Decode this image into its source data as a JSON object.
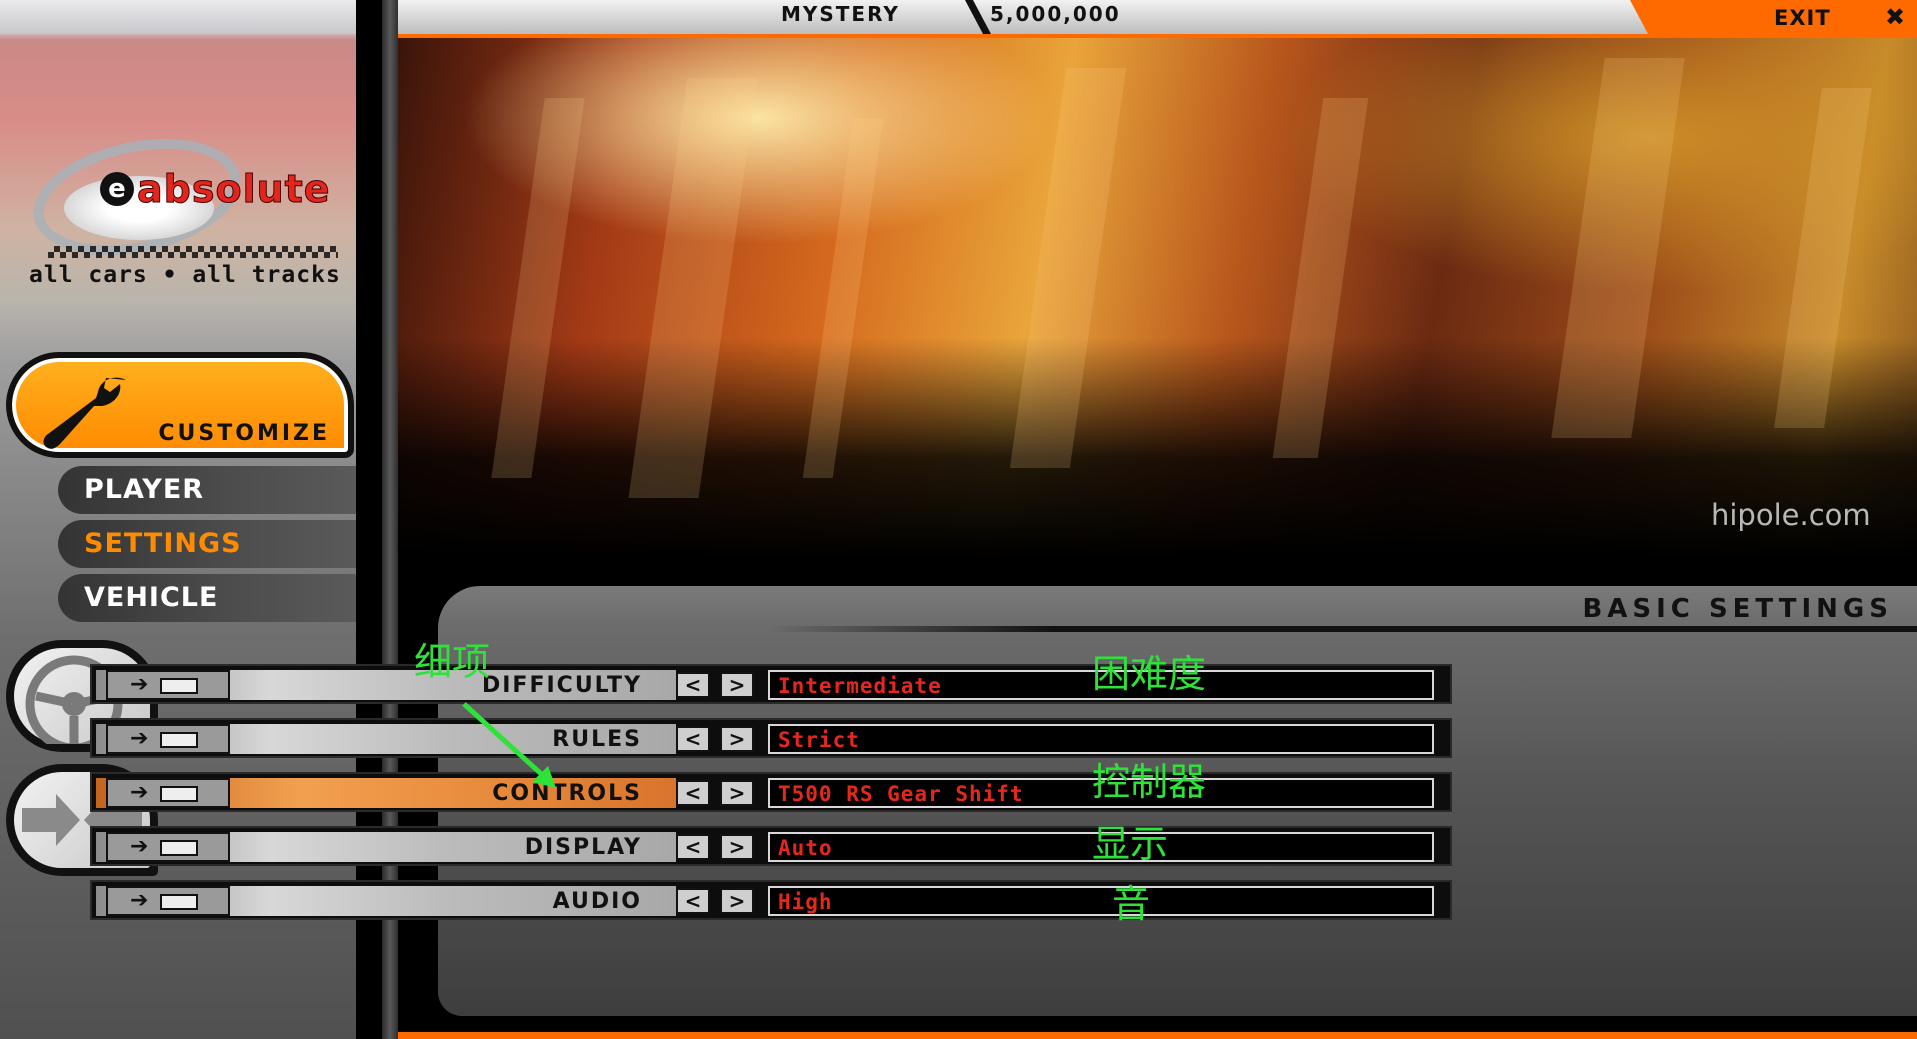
{
  "sidebar": {
    "logo_text": "absolute",
    "logo_badge": "e",
    "tagline": "all cars • all tracks",
    "customize_label": "CUSTOMIZE",
    "nav": [
      {
        "label": "PLAYER",
        "active": false
      },
      {
        "label": "SETTINGS",
        "active": true
      },
      {
        "label": "VEHICLE",
        "active": false
      }
    ]
  },
  "topbar": {
    "mode": "MYSTERY",
    "money": "5,000,000",
    "exit_label": "EXIT",
    "exit_icon": "✖"
  },
  "watermark": "hipole.com",
  "panel": {
    "title": "BASIC SETTINGS",
    "rows": [
      {
        "label": "DIFFICULTY",
        "value": "Intermediate",
        "note": "困难度",
        "active": false
      },
      {
        "label": "RULES",
        "value": "Strict",
        "note": "",
        "active": false
      },
      {
        "label": "CONTROLS",
        "value": "T500 RS Gear Shift",
        "note": "控制器",
        "active": true
      },
      {
        "label": "DISPLAY",
        "value": "Auto",
        "note": "显示",
        "active": false
      },
      {
        "label": "AUDIO",
        "value": "High",
        "note": "音",
        "active": false
      }
    ]
  },
  "annotations": {
    "detail": "细项"
  },
  "colors": {
    "accent": "#ff8c00",
    "value_text": "#e6281c",
    "note_text": "#2ee23a"
  }
}
